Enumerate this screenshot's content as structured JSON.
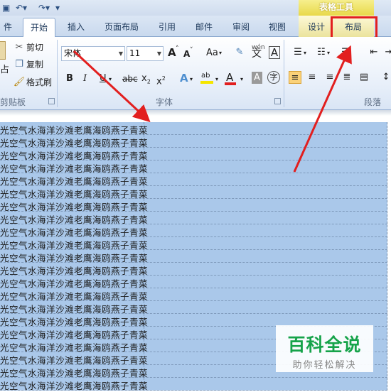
{
  "quick_access": {
    "save_icon": "save-icon",
    "undo_icon": "undo-icon",
    "redo_icon": "redo-icon",
    "customize_icon": "customize-icon"
  },
  "context_group": {
    "label": "表格工具",
    "color": "#e8d94a"
  },
  "tabs": [
    {
      "label": "件"
    },
    {
      "label": "开始",
      "active": true
    },
    {
      "label": "插入"
    },
    {
      "label": "页面布局"
    },
    {
      "label": "引用"
    },
    {
      "label": "邮件"
    },
    {
      "label": "审阅"
    },
    {
      "label": "视图"
    },
    {
      "label": "设计"
    },
    {
      "label": "布局",
      "highlighted": true
    }
  ],
  "clipboard": {
    "paste_label": "占",
    "cut_label": "剪切",
    "copy_label": "复制",
    "format_painter_label": "格式刷",
    "group_label": "剪贴板"
  },
  "font": {
    "font_name": "宋体",
    "font_size": "11",
    "grow_label": "A",
    "shrink_label": "A",
    "change_case_label": "Aa",
    "clear_format_icon": "clear-format-icon",
    "phonetic_label": "wén",
    "phonetic_char": "文",
    "border_char": "A",
    "bold": "B",
    "italic": "I",
    "underline": "U",
    "strikethrough": "abc",
    "subscript": "x",
    "subscript_mark": "2",
    "superscript": "x",
    "superscript_mark": "2",
    "text_effects": "A",
    "highlight": "ab",
    "font_color": "A",
    "char_shading": "A",
    "enclose_char": "字",
    "group_label": "字体"
  },
  "paragraph": {
    "group_label": "段落"
  },
  "table": {
    "row_text": "光空气水海洋沙滩老鹰海鸥燕子青菜",
    "row_count": 21,
    "selection_color": "#aac8ea"
  },
  "annotation": {
    "box_color": "#e21f1f",
    "arrow_color": "#e21f1f"
  },
  "watermark": {
    "title": "百科全说",
    "subtitle": "助你轻松解决",
    "title_color": "#16a34a"
  }
}
